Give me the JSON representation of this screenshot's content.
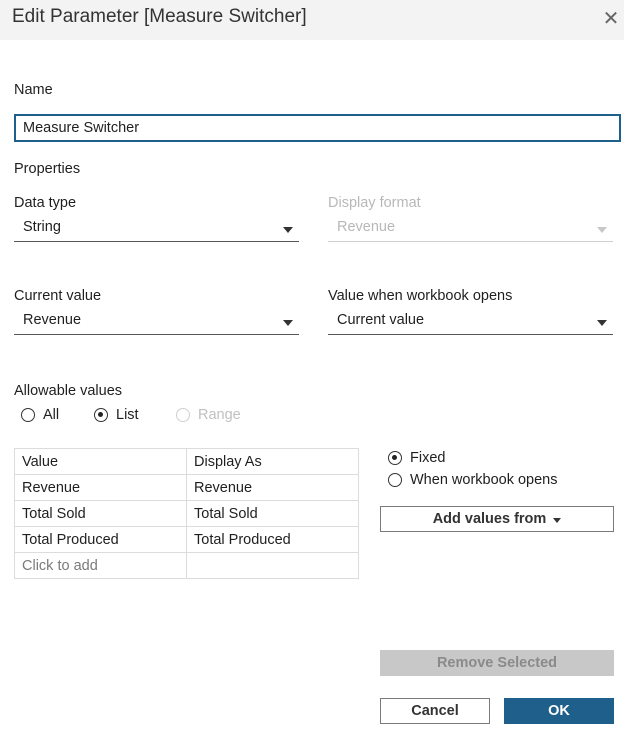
{
  "dialog": {
    "title": "Edit Parameter [Measure Switcher]",
    "close_icon": "close-icon"
  },
  "name": {
    "label": "Name",
    "value": "Measure Switcher"
  },
  "properties": {
    "heading": "Properties",
    "data_type": {
      "label": "Data type",
      "value": "String"
    },
    "display_format": {
      "label": "Display format",
      "value": "Revenue",
      "disabled": true
    },
    "current_value": {
      "label": "Current value",
      "value": "Revenue"
    },
    "value_when_opens": {
      "label": "Value when workbook opens",
      "value": "Current value"
    }
  },
  "allowable_values": {
    "label": "Allowable values",
    "options": [
      {
        "label": "All",
        "checked": false
      },
      {
        "label": "List",
        "checked": true
      },
      {
        "label": "Range",
        "checked": false,
        "disabled": true
      }
    ]
  },
  "list_table": {
    "headers": [
      "Value",
      "Display As"
    ],
    "rows": [
      [
        "Revenue",
        "Revenue"
      ],
      [
        "Total Sold",
        "Total Sold"
      ],
      [
        "Total Produced",
        "Total Produced"
      ]
    ],
    "add_placeholder": "Click to add"
  },
  "list_source": {
    "options": [
      {
        "label": "Fixed",
        "checked": true
      },
      {
        "label": "When workbook opens",
        "checked": false
      }
    ],
    "add_values_button": "Add values from"
  },
  "buttons": {
    "remove_selected": "Remove Selected",
    "cancel": "Cancel",
    "ok": "OK"
  },
  "colors": {
    "accent": "#1f5f8b",
    "title_bar": "#f3f3f3",
    "disabled_button": "#c8c8c8"
  }
}
